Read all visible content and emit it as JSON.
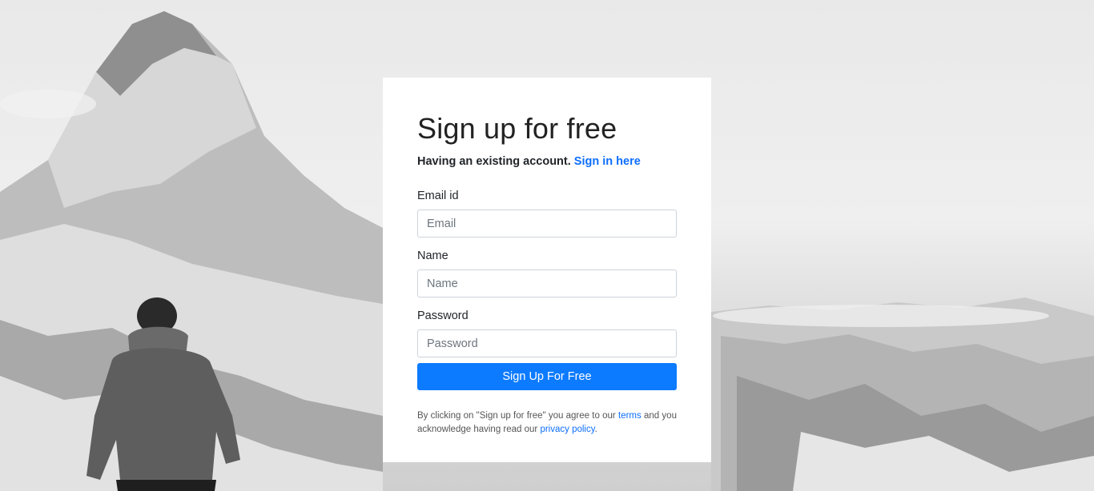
{
  "signup": {
    "title": "Sign up for free",
    "subtitle_text": "Having an existing account.",
    "signin_link": "Sign in here",
    "email_label": "Email id",
    "email_placeholder": "Email",
    "name_label": "Name",
    "name_placeholder": "Name",
    "password_label": "Password",
    "password_placeholder": "Password",
    "submit_label": "Sign Up For Free",
    "legal_pre": "By clicking on \"Sign up for free\" you agree to our",
    "terms_link": "terms",
    "legal_mid": "and you acknowledge having read our",
    "privacy_link": "privacy policy",
    "legal_post": "."
  },
  "colors": {
    "accent": "#0d7bff",
    "link": "#0d6efd",
    "card_background": "#ffffff"
  }
}
